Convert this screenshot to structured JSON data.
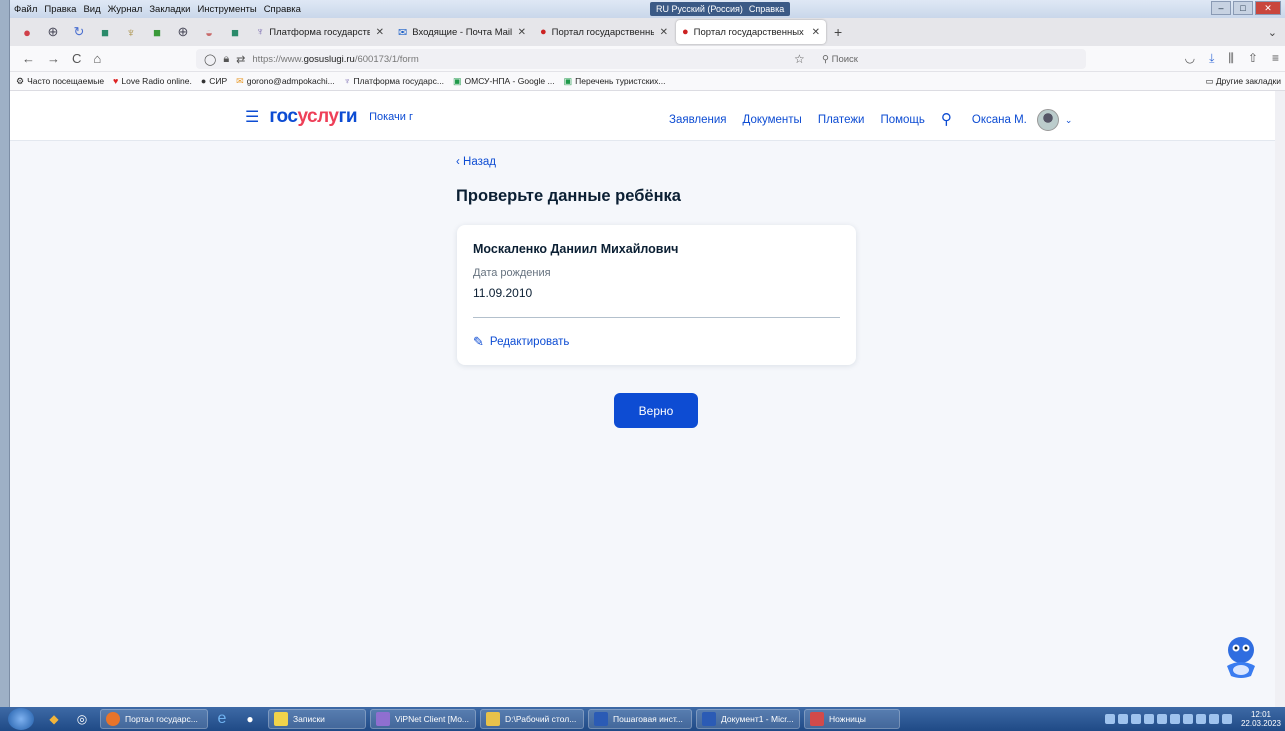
{
  "browser": {
    "menu": [
      "Файл",
      "Правка",
      "Вид",
      "Журнал",
      "Закладки",
      "Инструменты",
      "Справка"
    ],
    "language_indicator": "RU Русский (Россия)",
    "help_label": "Справка",
    "tabs": [
      {
        "label": "Платформа государственны",
        "favicon": "emblem-icon"
      },
      {
        "label": "Входящие - Почта Mail.ru",
        "favicon": "mail-icon"
      },
      {
        "label": "Портал государственных услу",
        "favicon": "flag-icon"
      },
      {
        "label": "Портал государственных услу",
        "favicon": "flag-icon",
        "active": true
      }
    ],
    "url_prefix": "https://www.",
    "url_domain": "gosuslugi.ru",
    "url_path": "/600173/1/form",
    "search_placeholder": "Поиск",
    "bookmarks": [
      {
        "label": "Часто посещаемые",
        "icon": "gear-icon"
      },
      {
        "label": "Love Radio online.",
        "icon": "radio-icon"
      },
      {
        "label": "СИР",
        "icon": "circle-icon"
      },
      {
        "label": "gorono@admpokachi...",
        "icon": "mail-icon"
      },
      {
        "label": "Платформа государс...",
        "icon": "emblem-icon"
      },
      {
        "label": "ОМСУ-НПА - Google ...",
        "icon": "sheet-icon"
      },
      {
        "label": "Перечень туристских...",
        "icon": "sheet-icon"
      }
    ],
    "other_bookmarks": "Другие закладки"
  },
  "site": {
    "logo": {
      "part1": "гос",
      "part2": "услу",
      "part3": "ги"
    },
    "city": "Покачи г",
    "nav": [
      "Заявления",
      "Документы",
      "Платежи",
      "Помощь"
    ],
    "user_name": "Оксана М.",
    "accent_color": "#0d4cd3",
    "logo_red": "#ee3f58"
  },
  "main": {
    "back_label": "Назад",
    "title": "Проверьте данные ребёнка",
    "card": {
      "full_name": "Москаленко Даниил Михайлович",
      "birth_label": "Дата рождения",
      "birth_value": "11.09.2010",
      "edit_label": "Редактировать"
    },
    "confirm_button": "Верно"
  },
  "taskbar": {
    "items": [
      {
        "label": "Портал государс...",
        "color": "#e8742a"
      },
      {
        "label": "Записки",
        "color": "#f2d34a"
      },
      {
        "label": "ViPNet Client [Mo...",
        "color": "#8f6fd0"
      },
      {
        "label": "D:\\Рабочий стол...",
        "color": "#e8c24a"
      },
      {
        "label": "Пошаговая инст...",
        "color": "#2b5bb5"
      },
      {
        "label": "Документ1 - Micr...",
        "color": "#2b5bb5"
      },
      {
        "label": "Ножницы",
        "color": "#d24a4a"
      }
    ],
    "time": "12:01",
    "date": "22.03.2023"
  }
}
